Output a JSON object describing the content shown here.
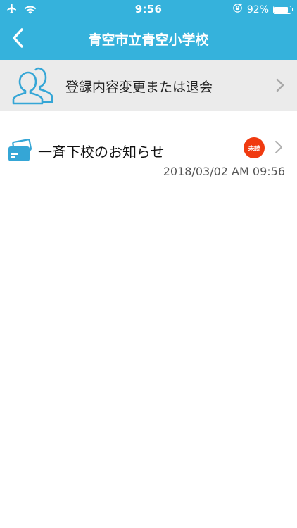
{
  "status_bar": {
    "time": "9:56",
    "battery_percent": "92%",
    "battery_level": 0.92
  },
  "nav": {
    "title": "青空市立青空小学校"
  },
  "settings_row": {
    "label": "登録内容変更または退会"
  },
  "notices": [
    {
      "title": "一斉下校のお知らせ",
      "badge": "未読",
      "timestamp": "2018/03/02 AM 09:56"
    }
  ],
  "colors": {
    "header_bg": "#35b2dc",
    "settings_bg": "#ebebeb",
    "icon_blue": "#35a6d6",
    "badge_red": "#f03a10"
  },
  "icons": {
    "airplane": "airplane-icon",
    "wifi": "wifi-icon",
    "rotation_lock": "rotation-lock-icon",
    "battery": "battery-icon",
    "back": "chevron-left-icon",
    "users": "users-icon",
    "chevron": "chevron-right-icon",
    "notice": "notice-card-icon"
  }
}
